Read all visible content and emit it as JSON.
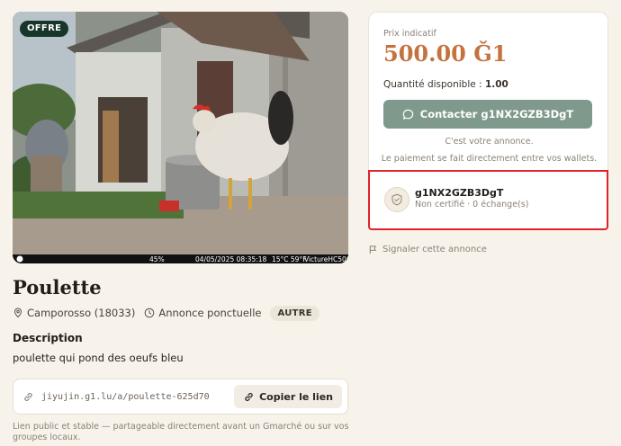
{
  "listing": {
    "badge": "OFFRE",
    "title": "Poulette",
    "location": "Camporosso (18033)",
    "kind": "Annonce ponctuelle",
    "category": "AUTRE",
    "description_heading": "Description",
    "description": "poulette qui pond des oeufs bleu",
    "photo_overlay": {
      "battery": "45%",
      "datetime": "04/05/2025 08:35:18",
      "temperature": "15°C 59°F",
      "camera": "VictureHC500"
    }
  },
  "share": {
    "url": "jiyujin.g1.lu/a/poulette-625d70",
    "copy_label": "Copier le lien",
    "note": "Lien public et stable — partageable directement avant un Gmarché ou sur vos groupes locaux."
  },
  "price": {
    "label": "Prix indicatif",
    "value": "500.00 Ǧ1",
    "quantity_label": "Quantité disponible :",
    "quantity_value": "1.00"
  },
  "contact": {
    "button_label": "Contacter g1NX2GZB3DgT",
    "own_note": "C'est votre annonce.",
    "payment_note": "Le paiement se fait directement entre vos wallets."
  },
  "seller": {
    "name": "g1NX2GZB3DgT",
    "status": "Non certifié · 0 échange(s)"
  },
  "report_label": "Signaler cette annonce",
  "colors": {
    "background": "#f7f2ea",
    "accent_price": "#c4733f",
    "contact_button": "#7f9a8c",
    "badge": "#17352a",
    "highlight": "#e0232a"
  }
}
